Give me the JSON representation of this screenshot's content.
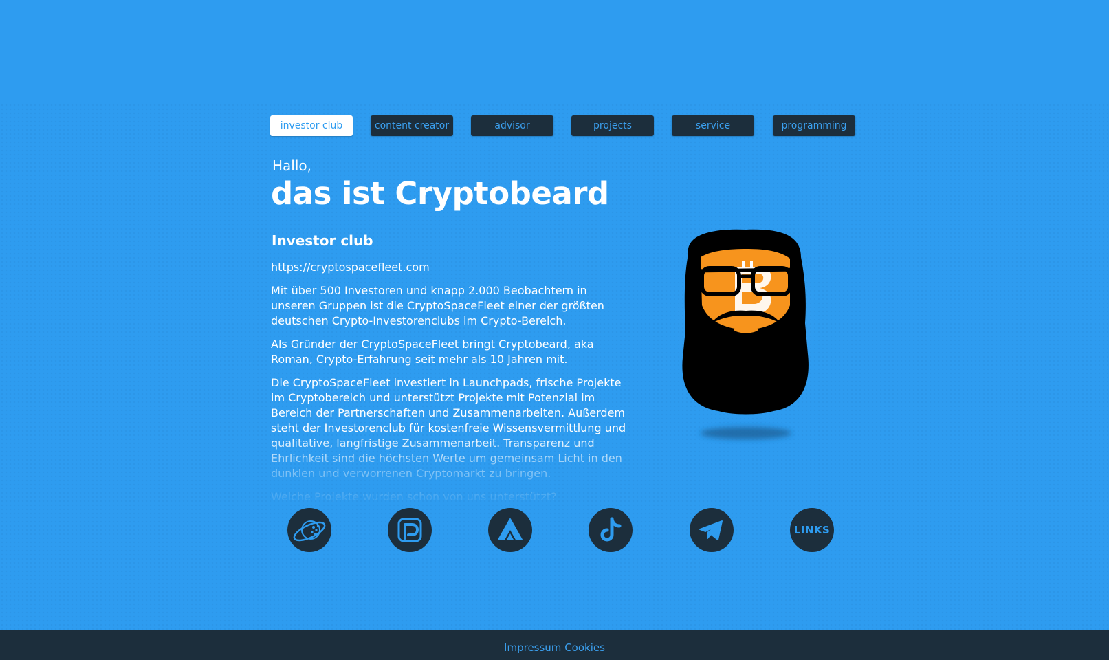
{
  "nav": {
    "items": [
      {
        "label": "investor club",
        "active": true
      },
      {
        "label": "content creator",
        "active": false
      },
      {
        "label": "advisor",
        "active": false
      },
      {
        "label": "projects",
        "active": false
      },
      {
        "label": "service",
        "active": false
      },
      {
        "label": "programming",
        "active": false
      }
    ]
  },
  "hero": {
    "greeting": "Hallo,",
    "headline": "das ist Cryptobeard"
  },
  "section": {
    "title": "Investor club",
    "link": "https://cryptospacefleet.com",
    "paragraphs": [
      "Mit über 500 Investoren und knapp 2.000 Beobachtern in unseren Gruppen ist die CryptoSpaceFleet einer der größten deutschen Crypto-Investorenclubs im Crypto-Bereich.",
      "Als Gründer der CryptoSpaceFleet bringt Cryptobeard, aka Roman, Crypto-Erfahrung seit mehr als 10 Jahren mit.",
      "Die CryptoSpaceFleet investiert in Launchpads, frische Projekte im Cryptobereich und unterstützt Projekte mit Potenzial im Bereich der Partnerschaften und Zusammenarbeiten. Außerdem steht der Investorenclub für kostenfreie Wissensvermittlung und qualitative, langfristige Zusammenarbeit. Transparenz und Ehrlichkeit sind die höchsten Werte um gemeinsam Licht in den dunklen und verworrenen Cryptomarkt zu bringen.",
      "Welche Projekte wurden schon von uns unterstützt?"
    ]
  },
  "socials": {
    "items": [
      {
        "icon": "planet-icon"
      },
      {
        "icon": "patreon-icon"
      },
      {
        "icon": "arweave-icon"
      },
      {
        "icon": "tiktok-icon"
      },
      {
        "icon": "telegram-icon"
      },
      {
        "icon": "links-icon",
        "label": "LINKS"
      }
    ]
  },
  "footer": {
    "impressum": "Impressum",
    "cookies": "Cookies"
  },
  "colors": {
    "background": "#2e9cf0",
    "dark": "#1c2e3c",
    "accent": "#3ba0ef",
    "orange": "#f7941d"
  }
}
